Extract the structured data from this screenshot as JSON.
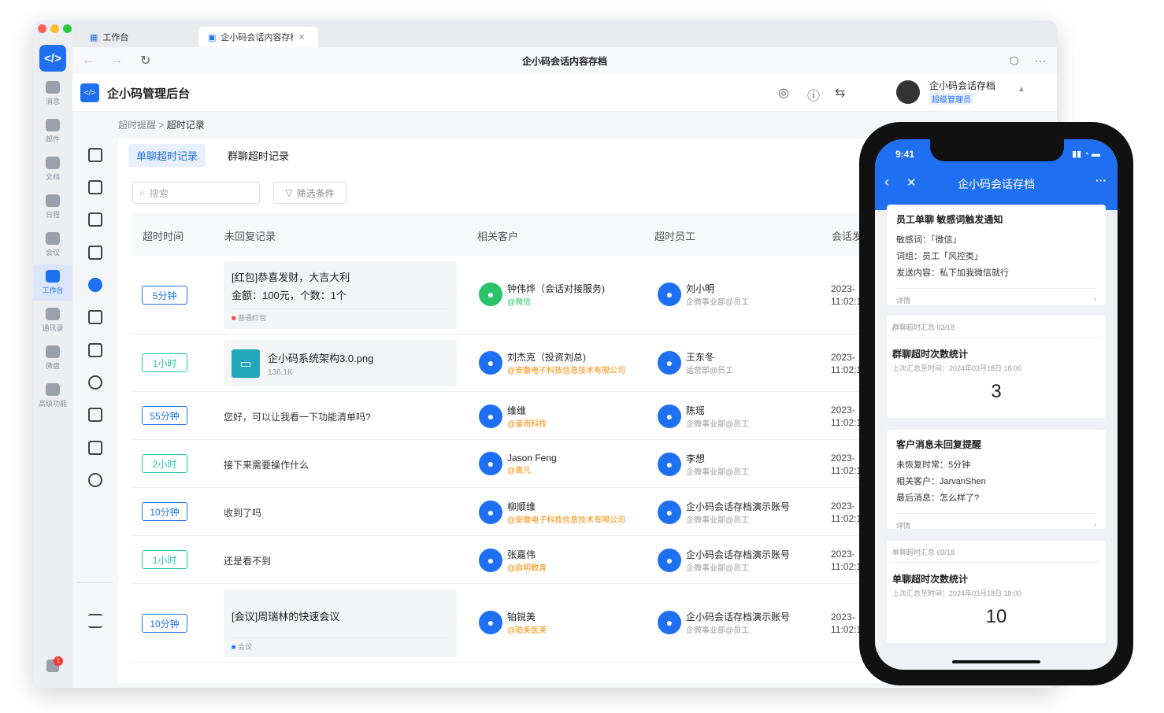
{
  "browser": {
    "tabs": [
      {
        "label": "工作台"
      },
      {
        "label": "企小码会话内容存档"
      }
    ],
    "page_title": "企小码会话内容存档"
  },
  "left_rail": {
    "items": [
      {
        "label": "消息"
      },
      {
        "label": "邮件"
      },
      {
        "label": "文档"
      },
      {
        "label": "日程"
      },
      {
        "label": "会议"
      },
      {
        "label": "工作台"
      },
      {
        "label": "通讯录"
      },
      {
        "label": "微盘"
      },
      {
        "label": "高级功能"
      }
    ],
    "notification_count": "1"
  },
  "app": {
    "title": "企小码管理后台",
    "user_name": "企小码会话存档",
    "user_role": "超级管理员"
  },
  "breadcrumb": {
    "parent": "超时提醒",
    "current": "超时记录"
  },
  "subtabs": [
    {
      "label": "单聊超时记录"
    },
    {
      "label": "群聊超时记录"
    }
  ],
  "search": {
    "placeholder": "搜索"
  },
  "filter_label": "筛选条件",
  "columns": [
    "超时时间",
    "未回复记录",
    "相关客户",
    "超时员工",
    "会话发"
  ],
  "rows": [
    {
      "duration": "5分钟",
      "msg_line1": "[红包]恭喜发财，大吉大利",
      "msg_line2": "金额：100元，个数：1个",
      "msg_footer": "普通红包",
      "customer": "钟伟烨（会话对接服务)",
      "customer_tag": "@微信",
      "employee": "刘小明",
      "employee_dept": "企微事业部@员工",
      "time1": "2023-",
      "time2": "11:02:1"
    },
    {
      "duration": "1小时",
      "file_name": "企小码系统架构3.0.png",
      "file_size": "136.1K",
      "customer": "刘杰克（投资刘总)",
      "customer_tag": "@安徽电子科技信息技术有限公司",
      "employee": "王东冬",
      "employee_dept": "运营部@员工",
      "time1": "2023-",
      "time2": "11:02:1"
    },
    {
      "duration": "55分钟",
      "msg": "您好，可以让我看一下功能清单吗?",
      "customer": "维维",
      "customer_tag": "@道雨科技",
      "employee": "陈瑶",
      "employee_dept": "企微事业部@员工",
      "time1": "2023-",
      "time2": "11:02:1"
    },
    {
      "duration": "2小时",
      "msg": "接下来需要操作什么",
      "customer": "Jason Feng",
      "customer_tag": "@嵩凡",
      "employee": "李想",
      "employee_dept": "企微事业部@员工",
      "time1": "2023-",
      "time2": "11:02:1"
    },
    {
      "duration": "10分钟",
      "msg": "收到了吗",
      "customer": "柳顺维",
      "customer_tag": "@安徽电子科技信息技术有限公司",
      "employee": "企小码会话存档演示账号",
      "employee_dept": "企微事业部@员工",
      "time1": "2023-",
      "time2": "11:02:1"
    },
    {
      "duration": "1小时",
      "msg": "还是看不到",
      "customer": "张嘉伟",
      "customer_tag": "@启明教育",
      "employee": "企小码会话存档演示账号",
      "employee_dept": "企微事业部@员工",
      "time1": "2023-",
      "time2": "11:02:1"
    },
    {
      "duration": "10分钟",
      "msg_line1": "[会议]周瑞林的快速会议",
      "msg_footer": "会议",
      "customer": "铂锐美",
      "customer_tag": "@珀美医美",
      "employee": "企小码会话存档演示账号",
      "employee_dept": "企微事业部@员工",
      "time1": "2023-",
      "time2": "11:02:1"
    }
  ],
  "phone": {
    "time": "9:41",
    "title": "企小码会话存档",
    "card1": {
      "title": "员工单聊 敏感词触发通知",
      "l1": "敏感词：「微信」",
      "l2": "词组：员工「风控类」",
      "l3": "发送内容：私下加我微信就行",
      "detail": "详情"
    },
    "card2": {
      "head": "群聊超时汇总 03/18",
      "title": "群聊超时次数统计",
      "sub": "上次汇总至时间：2024年03月18日 18:00",
      "num": "3"
    },
    "card3": {
      "title": "客户消息未回复提醒",
      "l1": "未恢复时常：5分钟",
      "l2": "相关客户：JarvanShen",
      "l3": "最后消息：怎么样了?",
      "detail": "详情"
    },
    "card4": {
      "head": "单聊超时汇总 03/18",
      "title": "单聊超时次数统计",
      "sub": "上次汇总至时间：2024年03月18日 18:00",
      "num": "10"
    }
  }
}
